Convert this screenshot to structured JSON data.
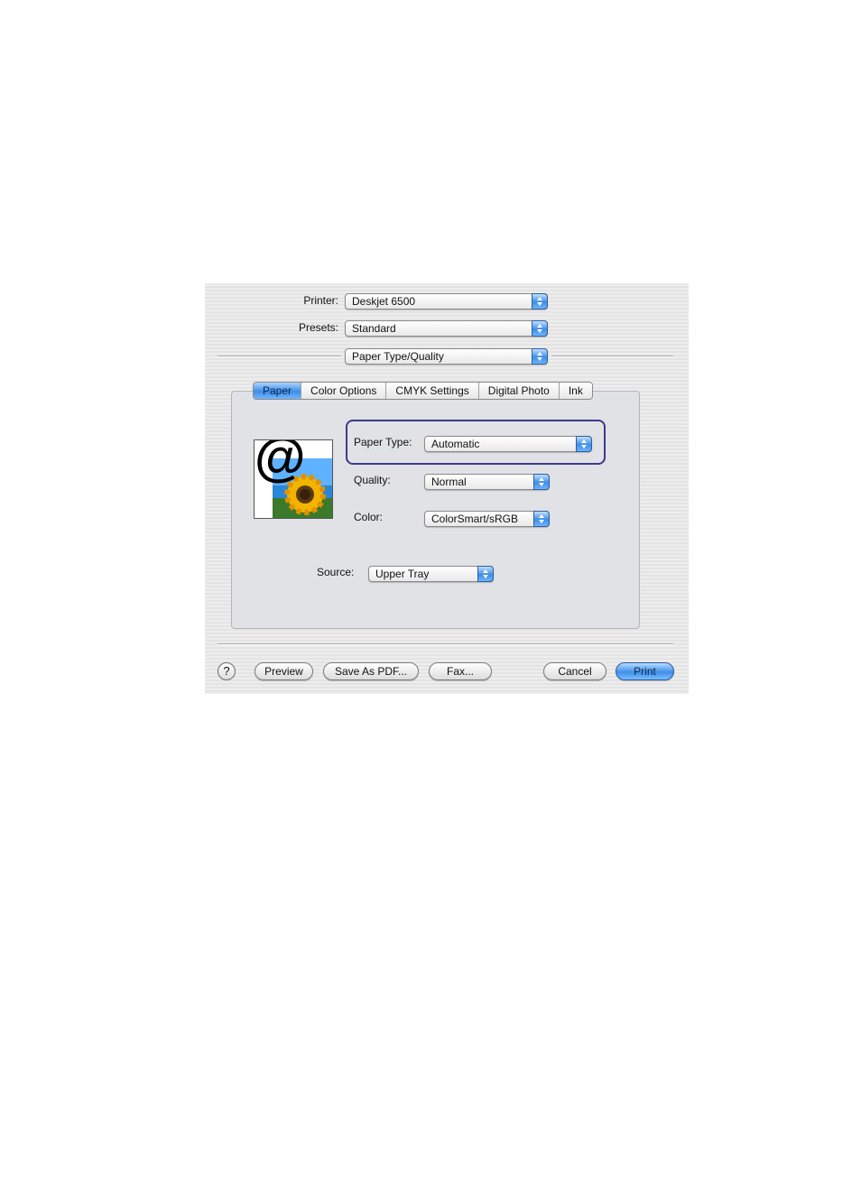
{
  "printer": {
    "label": "Printer:",
    "value": "Deskjet 6500"
  },
  "presets": {
    "label": "Presets:",
    "value": "Standard"
  },
  "pane_selector": {
    "value": "Paper Type/Quality"
  },
  "tabs": [
    {
      "label": "Paper",
      "active": true
    },
    {
      "label": "Color Options",
      "active": false
    },
    {
      "label": "CMYK Settings",
      "active": false
    },
    {
      "label": "Digital Photo",
      "active": false
    },
    {
      "label": "Ink",
      "active": false
    }
  ],
  "paper_type": {
    "label": "Paper Type:",
    "value": "Automatic"
  },
  "quality": {
    "label": "Quality:",
    "value": "Normal"
  },
  "color": {
    "label": "Color:",
    "value": "ColorSmart/sRGB"
  },
  "source": {
    "label": "Source:",
    "value": "Upper Tray"
  },
  "preview_image": {
    "glyph": "@"
  },
  "buttons": {
    "help": "?",
    "preview": "Preview",
    "save_pdf": "Save As PDF...",
    "fax": "Fax...",
    "cancel": "Cancel",
    "print": "Print"
  },
  "colors": {
    "accent": "#3d8de6",
    "highlight_border": "#3b3a8a"
  }
}
